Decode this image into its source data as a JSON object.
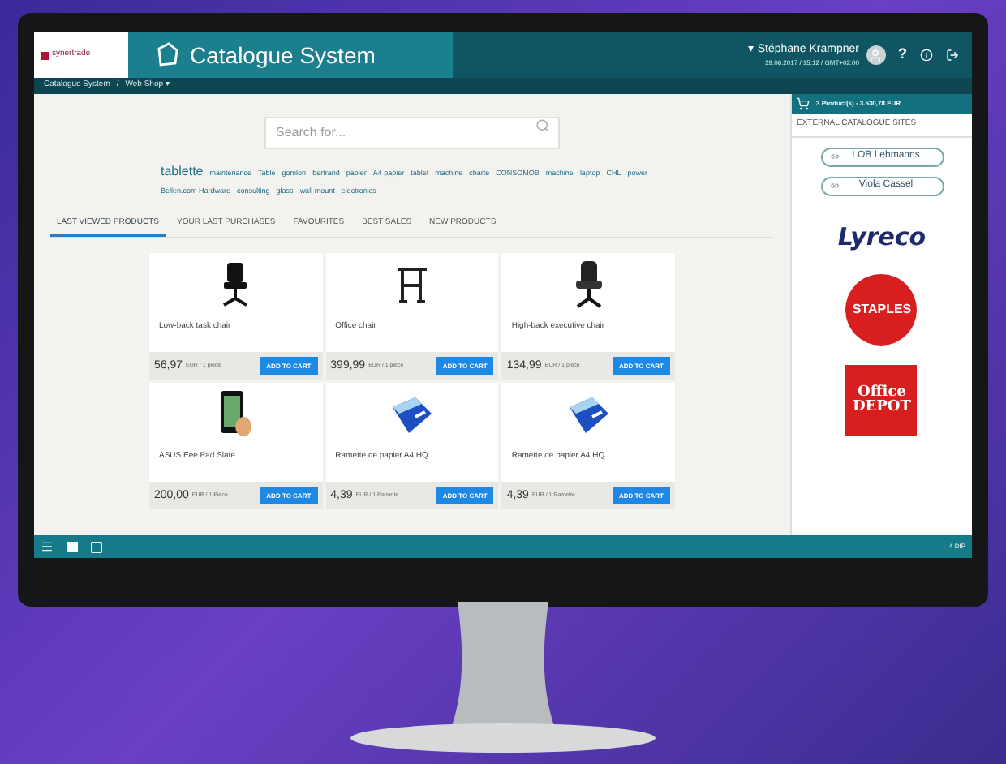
{
  "header": {
    "brand": "synertrade",
    "title": "Catalogue System",
    "user": "▾ Stéphane Krampner",
    "help": "?",
    "datetime": "29.06.2017 / 15:12 / GMT+02:00"
  },
  "breadcrumb": [
    "Catalogue System",
    "/",
    "Web Shop ▾"
  ],
  "search": {
    "placeholder": "Search for..."
  },
  "tags": [
    {
      "label": "tablette",
      "kind": "main"
    },
    {
      "label": "maintenance",
      "kind": "normal"
    },
    {
      "label": "Table",
      "kind": "normal"
    },
    {
      "label": "gomlon",
      "kind": "normal"
    },
    {
      "label": "bertrand",
      "kind": "normal"
    },
    {
      "label": "papier",
      "kind": "normal"
    },
    {
      "label": "A4 papier",
      "kind": "normal"
    },
    {
      "label": "tablet",
      "kind": "normal"
    },
    {
      "label": "machine",
      "kind": "normal"
    },
    {
      "label": "charte",
      "kind": "normal"
    },
    {
      "label": "CONSOMOB",
      "kind": "normal"
    },
    {
      "label": "machine",
      "kind": "normal"
    },
    {
      "label": "laptop",
      "kind": "normal"
    },
    {
      "label": "CHL",
      "kind": "normal"
    },
    {
      "label": "power",
      "kind": "normal"
    },
    {
      "label": "Bellen.com Hardware",
      "kind": "normal"
    },
    {
      "label": "consulting",
      "kind": "normal"
    },
    {
      "label": "glass",
      "kind": "normal"
    },
    {
      "label": "wall mount",
      "kind": "normal"
    },
    {
      "label": "electronics",
      "kind": "normal"
    }
  ],
  "tabs": [
    {
      "label": "LAST VIEWED PRODUCTS",
      "selected": true
    },
    {
      "label": "YOUR LAST PURCHASES",
      "selected": false
    },
    {
      "label": "FAVOURITES",
      "selected": false
    },
    {
      "label": "BEST SALES",
      "selected": false
    },
    {
      "label": "NEW PRODUCTS",
      "selected": false
    }
  ],
  "products": [
    {
      "kind": "chair",
      "name": "Low-back task chair",
      "price": "56,97",
      "unit": "EUR / 1 piece",
      "button": "ADD TO CART"
    },
    {
      "kind": "desk",
      "name": "Office chair",
      "price": "399,99",
      "unit": "EUR / 1 piece",
      "button": "ADD TO CART"
    },
    {
      "kind": "executive-chair",
      "name": "High-back executive chair",
      "price": "134,99",
      "unit": "EUR / 1 piece",
      "button": "ADD TO CART"
    },
    {
      "kind": "tablet",
      "name": "ASUS Eee Pad Slate",
      "price": "200,00",
      "unit": "EUR / 1 Piece",
      "button": "ADD TO CART"
    },
    {
      "kind": "paper",
      "name": "Ramette de papier A4 HQ",
      "price": "4,39",
      "unit": "EUR / 1 Ramette",
      "button": "ADD TO CART"
    },
    {
      "kind": "paper",
      "name": "Ramette de papier A4 HQ",
      "price": "4,39",
      "unit": "EUR / 1 Ramette",
      "button": "ADD TO CART"
    }
  ],
  "sidebar": {
    "cart": "3 Product(s) - 3.530,78 EUR",
    "heading": "EXTERNAL CATALOGUE SITES",
    "sites": [
      "LOB Lehmanns",
      "Viola Cassel"
    ],
    "logos": [
      {
        "kind": "lyreco",
        "label": "Lyreco"
      },
      {
        "kind": "staples",
        "label": "STAPLES"
      },
      {
        "kind": "depot",
        "label": "Office DEPOT"
      }
    ]
  },
  "taskbar": {
    "status": "4 DIP"
  }
}
